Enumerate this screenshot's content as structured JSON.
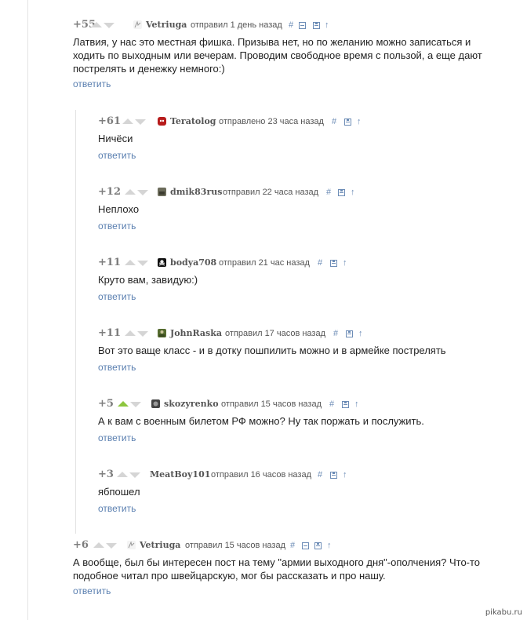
{
  "colors": {
    "accent_link": "#5a7fb0",
    "vote_up_active": "#8dc63f",
    "vote_inactive": "#d5d5d5"
  },
  "icons": [
    "vote-up-icon",
    "vote-down-icon",
    "link-hash-icon",
    "collapse-icon",
    "save-icon",
    "arrow-up-icon"
  ],
  "comments": [
    {
      "score": "+55",
      "author": "Vetriuga",
      "meta": "отправил 1 день назад",
      "text": "Латвия, у нас это местная фишка. Призыва нет, но по желанию можно записаться и ходить по выходным или вечерам. Проводим свободное время с пользой, а еще дают пострелять и денежку немного:)",
      "reply": "ответить",
      "hash": "#",
      "up": "↑"
    },
    {
      "score": "+61",
      "author": "Teratolog",
      "meta": "отправлено 23 часа назад",
      "text": "Ничёси",
      "reply": "ответить",
      "hash": "#",
      "up": "↑"
    },
    {
      "score": "+12",
      "author": "dmik83rus",
      "meta": "отправил 22 часа назад",
      "text": "Неплохо",
      "reply": "ответить",
      "hash": "#",
      "up": "↑"
    },
    {
      "score": "+11",
      "author": "bodya708",
      "meta": "отправил 21 час назад",
      "text": "Круто вам, завидую:)",
      "reply": "ответить",
      "hash": "#",
      "up": "↑"
    },
    {
      "score": "+11",
      "author": "JohnRaska",
      "meta": "отправил 17 часов назад",
      "text": "Вот это ваще класс - и в дотку пошпилить можно и в армейке пострелять",
      "reply": "ответить",
      "hash": "#",
      "up": "↑"
    },
    {
      "score": "+5",
      "author": "skozyrenko",
      "meta": "отправил 15 часов назад",
      "text": "А к вам с военным билетом РФ можно? Ну так поржать и послужить.",
      "reply": "ответить",
      "hash": "#",
      "up": "↑"
    },
    {
      "score": "+3",
      "author": "MeatBoy101",
      "meta": "отправил 16 часов назад",
      "text": "ябпошел",
      "reply": "ответить",
      "hash": "#",
      "up": "↑"
    },
    {
      "score": "+6",
      "author": "Vetriuga",
      "meta": "отправил 15 часов назад",
      "text": "А вообще, был бы интересен пост на тему \"армии выходного дня\"-ополчения? Что-то подобное читал про швейцарскую, мог бы рассказать и про нашу.",
      "reply": "ответить",
      "hash": "#",
      "up": "↑"
    }
  ],
  "watermark": "pikabu.ru"
}
